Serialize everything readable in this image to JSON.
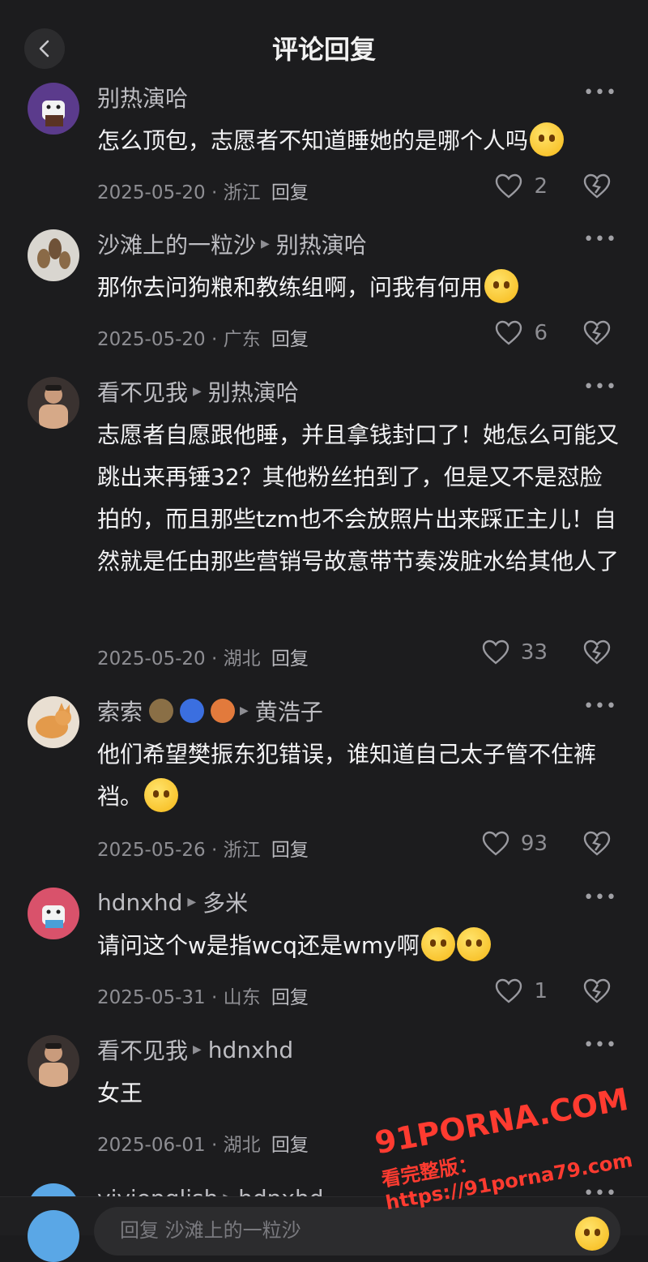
{
  "header": {
    "title": "评论回复"
  },
  "comments": [
    {
      "name": "别热演哈",
      "reply_to": "",
      "text": "怎么顶包，志愿者不知道睡她的是哪个人吗",
      "date": "2025-05-20",
      "location": "浙江",
      "reply_label": "回复",
      "likes": "2"
    },
    {
      "name": "沙滩上的一粒沙",
      "reply_to": "别热演哈",
      "text": "那你去问狗粮和教练组啊，问我有何用",
      "date": "2025-05-20",
      "location": "广东",
      "reply_label": "回复",
      "likes": "6"
    },
    {
      "name": "看不见我",
      "reply_to": "别热演哈",
      "text": "志愿者自愿跟他睡，并且拿钱封口了！她怎么可能又跳出来再锤32？其他粉丝拍到了，但是又不是怼脸拍的，而且那些tzm也不会放照片出来踩正主儿！自然就是任由那些营销号故意带节奏泼脏水给其他人了",
      "date": "2025-05-20",
      "location": "湖北",
      "reply_label": "回复",
      "likes": "33"
    },
    {
      "name": "索索",
      "reply_to": "黄浩子",
      "text": "他们希望樊振东犯错误，谁知道自己太子管不住裤裆。",
      "date": "2025-05-26",
      "location": "浙江",
      "reply_label": "回复",
      "likes": "93"
    },
    {
      "name": "hdnxhd",
      "reply_to": "多米",
      "text": "请问这个w是指wcq还是wmy啊",
      "date": "2025-05-31",
      "location": "山东",
      "reply_label": "回复",
      "likes": "1"
    },
    {
      "name": "看不见我",
      "reply_to": "hdnxhd",
      "text": "女王",
      "date": "2025-06-01",
      "location": "湖北",
      "reply_label": "回复",
      "likes": ""
    },
    {
      "name": "vivienglish",
      "reply_to": "hdnxhd"
    }
  ],
  "input": {
    "placeholder": "回复 沙滩上的一粒沙"
  },
  "watermark": {
    "line1": "91PORNA.COM",
    "line2": "看完整版：https://91porna79.com"
  },
  "colors": {
    "background": "#1c1c1e",
    "text": "#f2f2f4",
    "meta": "#8e8e93"
  }
}
